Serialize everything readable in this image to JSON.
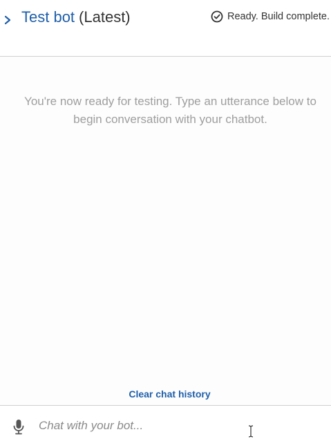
{
  "header": {
    "title": "Test bot",
    "version": "(Latest)",
    "status": "Ready. Build complete.",
    "status_icon": "check-circle-icon",
    "toggle_icon": "chevron-right-icon"
  },
  "chat": {
    "welcome_message": "You're now ready for testing. Type an utterance below to begin conversation with your chatbot.",
    "clear_history_label": "Clear chat history"
  },
  "input": {
    "placeholder": "Chat with your bot...",
    "value": "",
    "mic_icon": "microphone-icon"
  },
  "colors": {
    "accent": "#1f5faa",
    "muted_text": "#9e9e9e",
    "divider": "#cfcfcf"
  }
}
